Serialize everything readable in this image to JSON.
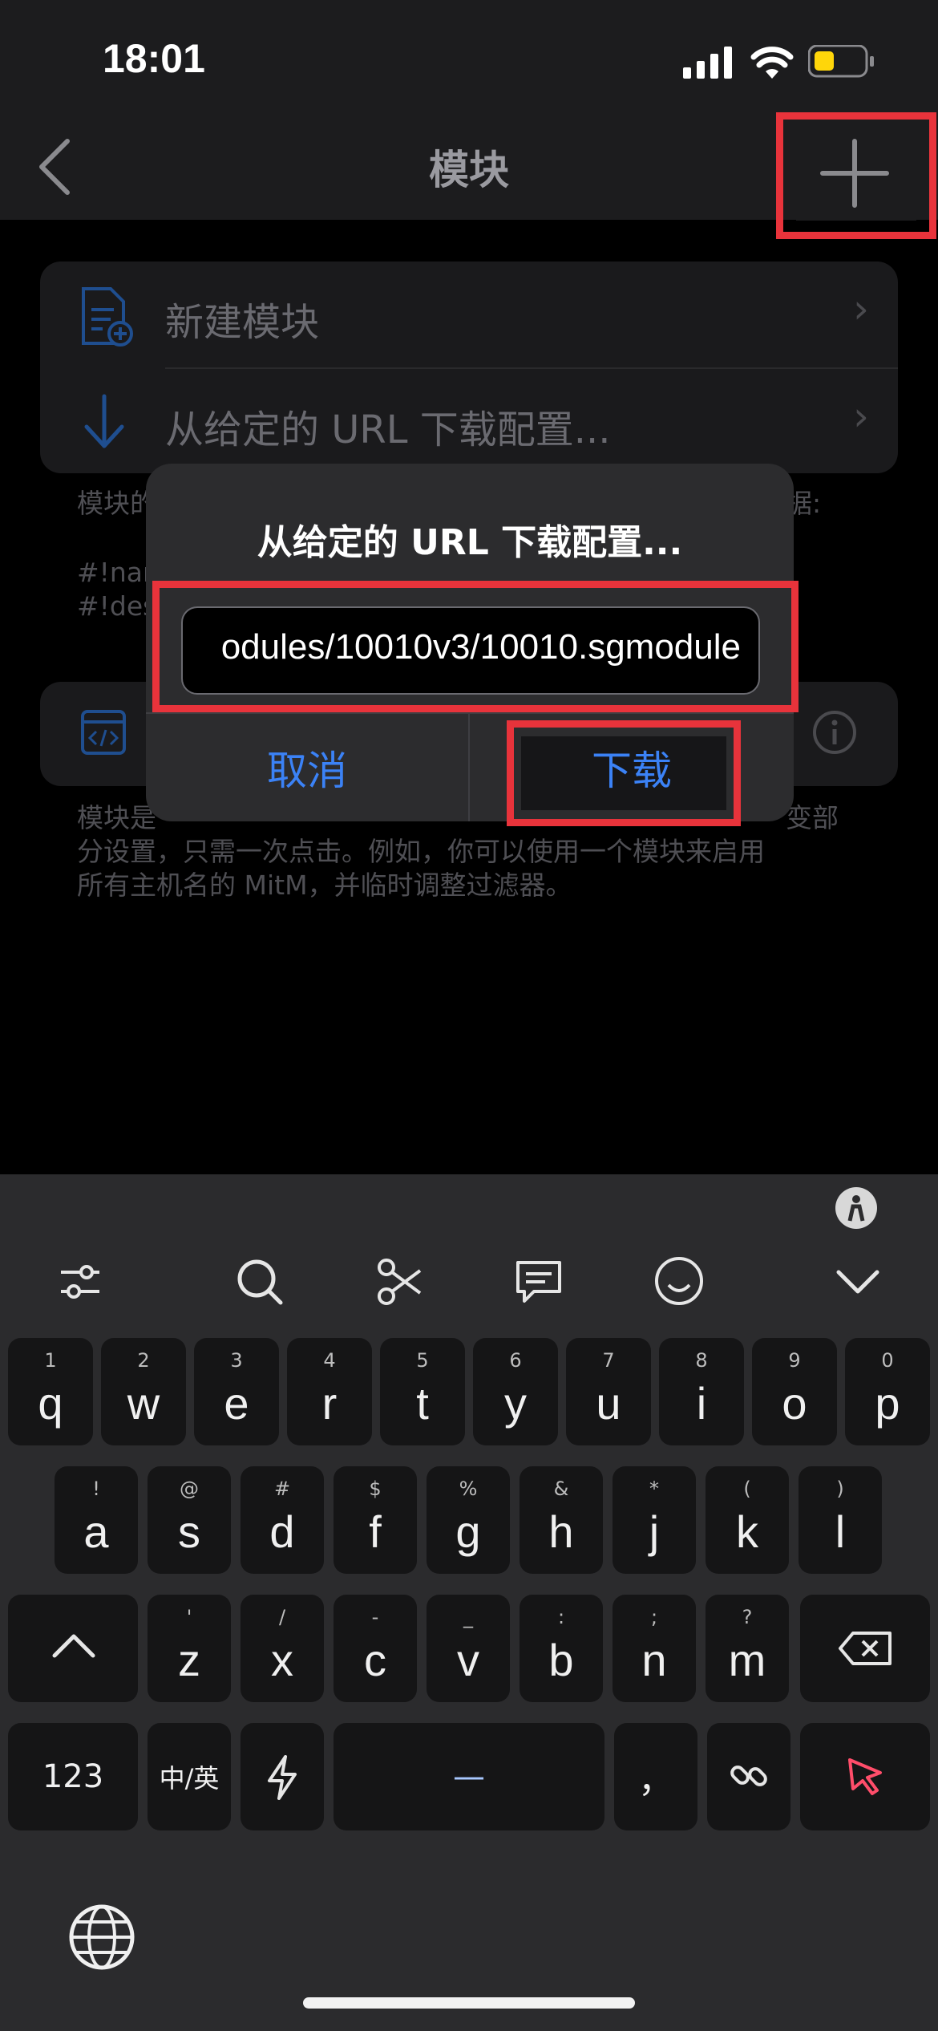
{
  "status_bar": {
    "time": "18:01"
  },
  "nav": {
    "title": "模块"
  },
  "list": {
    "new_module": "新建模块",
    "download_from_url": "从给定的 URL 下载配置...",
    "info_start": "模块的",
    "info_end": "据:",
    "code_line1": "#!nar",
    "code_line2": "#!des",
    "description_line1_start": "模块是",
    "description_line1_end": "变部",
    "description_line2": "分设置，只需一次点击。例如，你可以使用一个模块来启用",
    "description_line3": "所有主机名的 MitM，并临时调整过滤器。"
  },
  "dialog": {
    "title": "从给定的 URL 下载配置...",
    "url_value": "odules/10010v3/10010.sgmodule",
    "cancel_label": "取消",
    "download_label": "下载"
  },
  "keyboard": {
    "row1": [
      {
        "k": "q",
        "s": "1"
      },
      {
        "k": "w",
        "s": "2"
      },
      {
        "k": "e",
        "s": "3"
      },
      {
        "k": "r",
        "s": "4"
      },
      {
        "k": "t",
        "s": "5"
      },
      {
        "k": "y",
        "s": "6"
      },
      {
        "k": "u",
        "s": "7"
      },
      {
        "k": "i",
        "s": "8"
      },
      {
        "k": "o",
        "s": "9"
      },
      {
        "k": "p",
        "s": "0"
      }
    ],
    "row2": [
      {
        "k": "a",
        "s": "!"
      },
      {
        "k": "s",
        "s": "@"
      },
      {
        "k": "d",
        "s": "#"
      },
      {
        "k": "f",
        "s": "$"
      },
      {
        "k": "g",
        "s": "%"
      },
      {
        "k": "h",
        "s": "&"
      },
      {
        "k": "j",
        "s": "*"
      },
      {
        "k": "k",
        "s": "("
      },
      {
        "k": "l",
        "s": ")"
      }
    ],
    "row3": [
      {
        "k": "z",
        "s": "'"
      },
      {
        "k": "x",
        "s": "/"
      },
      {
        "k": "c",
        "s": "-"
      },
      {
        "k": "v",
        "s": "_"
      },
      {
        "k": "b",
        "s": ":"
      },
      {
        "k": "n",
        "s": ";"
      },
      {
        "k": "m",
        "s": "?"
      }
    ],
    "numbers_label": "123",
    "lang_label": "中/英",
    "punct_label": "，",
    "space_label": "—"
  },
  "colors": {
    "accent": "#3b82f6",
    "highlight": "#e8333b",
    "keyboard_bg": "#2b2b2d"
  }
}
